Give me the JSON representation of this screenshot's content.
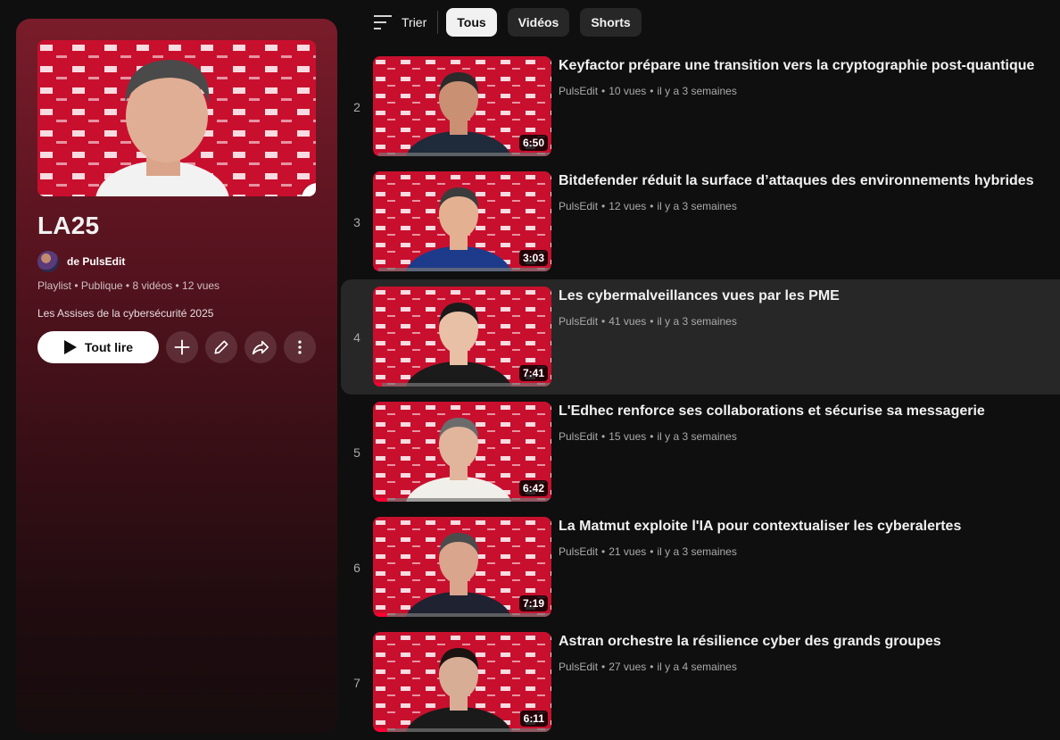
{
  "playlist": {
    "title": "LA25",
    "owner": "de PulsEdit",
    "meta": "Playlist • Publique • 8 vidéos • 12 vues",
    "description": "Les Assises de la cybersécurité 2025",
    "play_all_label": "Tout lire",
    "thumbnail_text": "LA25",
    "thumbnail_brand": "LES ASSISES",
    "icons": [
      "play-icon",
      "plus-icon",
      "pencil-icon",
      "share-icon",
      "more-vert-icon"
    ]
  },
  "filters": {
    "sort_label": "Trier",
    "chips": [
      {
        "label": "Tous",
        "selected": true
      },
      {
        "label": "Vidéos",
        "selected": false
      },
      {
        "label": "Shorts",
        "selected": false
      }
    ]
  },
  "videos": [
    {
      "index": "2",
      "title": "Keyfactor prépare une transition vers la cryptographie post-quantique",
      "channel": "PulsEdit",
      "views": "10 vues",
      "age": "il y a 3 semaines",
      "duration": "6:50",
      "watched": 0.03
    },
    {
      "index": "3",
      "title": "Bitdefender réduit la surface d’attaques des environnements hybrides",
      "channel": "PulsEdit",
      "views": "12 vues",
      "age": "il y a 3 semaines",
      "duration": "3:03",
      "watched": 0.03
    },
    {
      "index": "4",
      "title": "Les cybermalveillances vues par les PME",
      "channel": "PulsEdit",
      "views": "41 vues",
      "age": "il y a 3 semaines",
      "duration": "7:41",
      "watched": 0.05
    },
    {
      "index": "5",
      "title": "L'Edhec renforce ses collaborations et sécurise sa messagerie",
      "channel": "PulsEdit",
      "views": "15 vues",
      "age": "il y a 3 semaines",
      "duration": "6:42",
      "watched": 0.08
    },
    {
      "index": "6",
      "title": "La Matmut exploite l'IA pour contextualiser les cyberalertes",
      "channel": "PulsEdit",
      "views": "21 vues",
      "age": "il y a 3 semaines",
      "duration": "7:19",
      "watched": 0.08
    },
    {
      "index": "7",
      "title": "Astran orchestre la résilience cyber des grands groupes",
      "channel": "PulsEdit",
      "views": "27 vues",
      "age": "il y a 4 semaines",
      "duration": "6:11",
      "watched": 0.08
    }
  ],
  "colors": {
    "accent_red": "#ff0033",
    "panel_red": "#7a1c2a",
    "backdrop_red": "#c8102e"
  }
}
